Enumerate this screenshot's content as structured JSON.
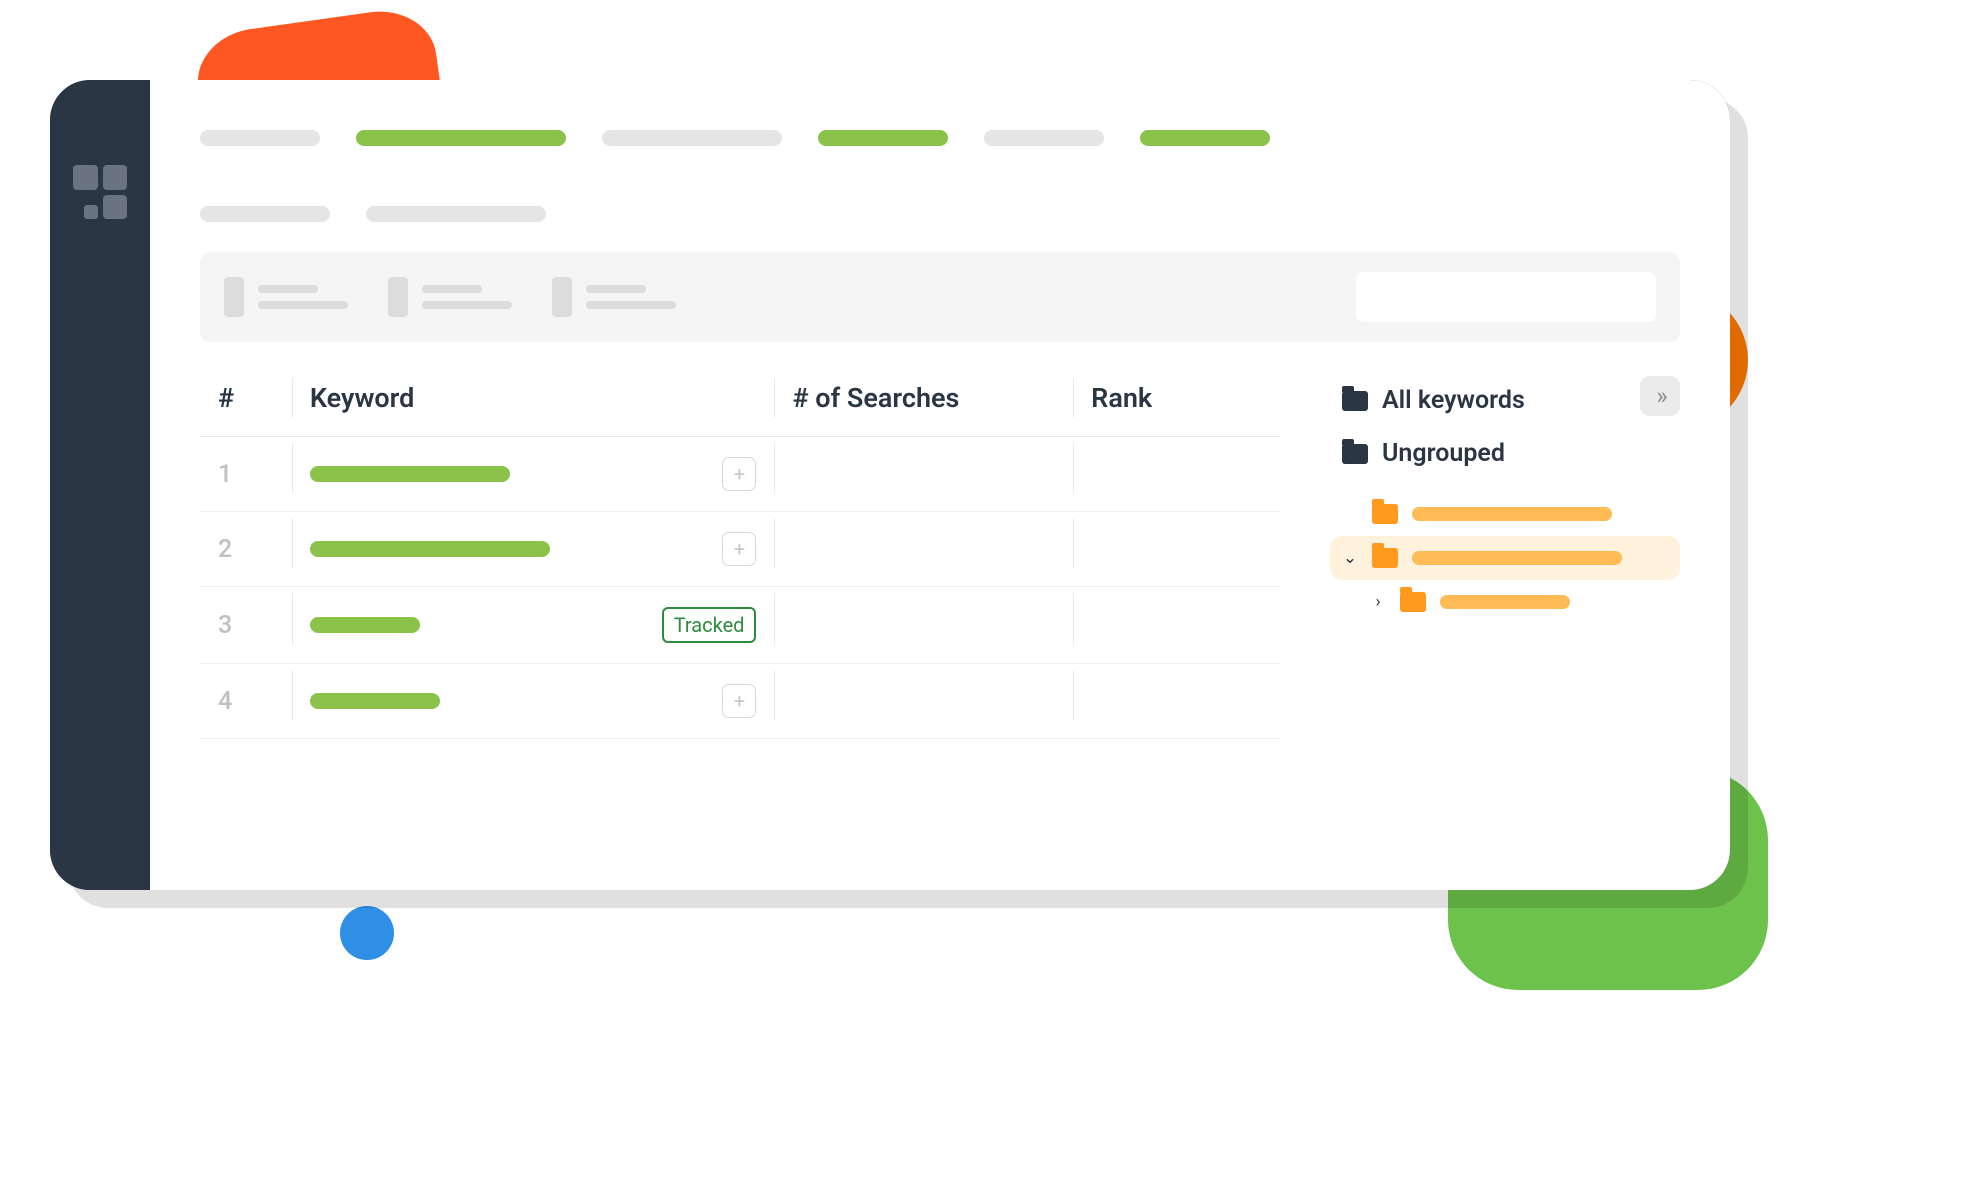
{
  "table": {
    "headers": {
      "num": "#",
      "keyword": "Keyword",
      "searches": "# of Searches",
      "rank": "Rank"
    },
    "rows": [
      {
        "num": "1",
        "tracked": false
      },
      {
        "num": "2",
        "tracked": false
      },
      {
        "num": "3",
        "tracked": true
      },
      {
        "num": "4",
        "tracked": false
      }
    ],
    "tracked_label": "Tracked"
  },
  "side": {
    "all": "All keywords",
    "ungrouped": "Ungrouped",
    "expand": "»"
  }
}
